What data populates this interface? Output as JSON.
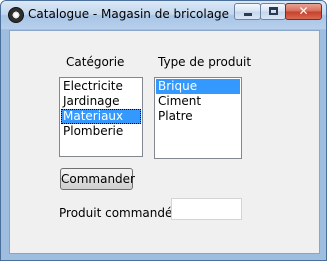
{
  "window": {
    "title": "Catalogue - Magasin de bricolage",
    "app_icon": "paw-icon",
    "controls": {
      "minimize": "minimize-icon",
      "maximize": "maximize-icon",
      "close": "close-icon"
    }
  },
  "categories": {
    "label": "Catégorie",
    "items": [
      "Electricite",
      "Jardinage",
      "Materiaux",
      "Plomberie"
    ],
    "selected": "Materiaux"
  },
  "product_types": {
    "label": "Type de produit",
    "items": [
      "Brique",
      "Ciment",
      "Platre"
    ],
    "selected": "Brique"
  },
  "order_button": {
    "label": "Commander"
  },
  "ordered_product": {
    "label": "Produit commandé",
    "value": ""
  },
  "colors": {
    "selection": "#3399ff",
    "client_bg": "#f0f0f0",
    "frame": "#9fbddf"
  }
}
